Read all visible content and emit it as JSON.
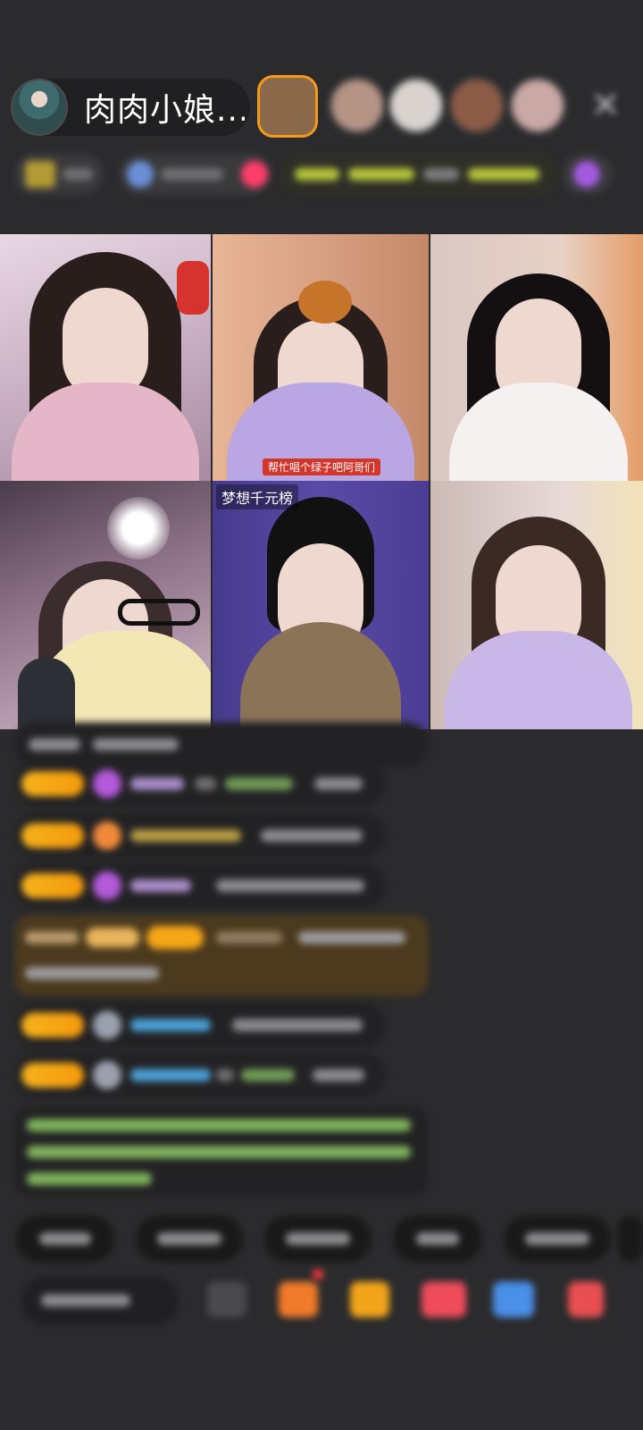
{
  "header": {
    "host_name": "肉肉小娘...",
    "avatar_icon": "host-avatar",
    "close_icon": "close-icon",
    "viewer_avatars": [
      {
        "ring": "#f39a1d",
        "fill": "#8a6a4b"
      },
      {
        "ring": "#3a3a3c",
        "fill": "#b59486"
      },
      {
        "ring": "#3a3a3c",
        "fill": "#d9d2cf"
      },
      {
        "ring": "#3a3a3c",
        "fill": "#8c5b46"
      },
      {
        "ring": "#3a3a3c",
        "fill": "#c9a8a5"
      }
    ]
  },
  "grid": {
    "tiles": [
      {
        "id": "guest-1"
      },
      {
        "id": "guest-2",
        "caption": "帮忙唱个绿子吧阿哥们"
      },
      {
        "id": "guest-3"
      },
      {
        "id": "guest-4"
      },
      {
        "id": "guest-5",
        "label": "梦想千元榜"
      },
      {
        "id": "guest-6"
      }
    ]
  },
  "colors": {
    "background": "#2b2b2d",
    "badge": "#f5a615",
    "chat_bg": "#222224",
    "highlight_bg": "#4c3a1e",
    "green_text": "#7fc35b",
    "purple": "#b25ad9",
    "blue_text": "#4a9fd6"
  }
}
